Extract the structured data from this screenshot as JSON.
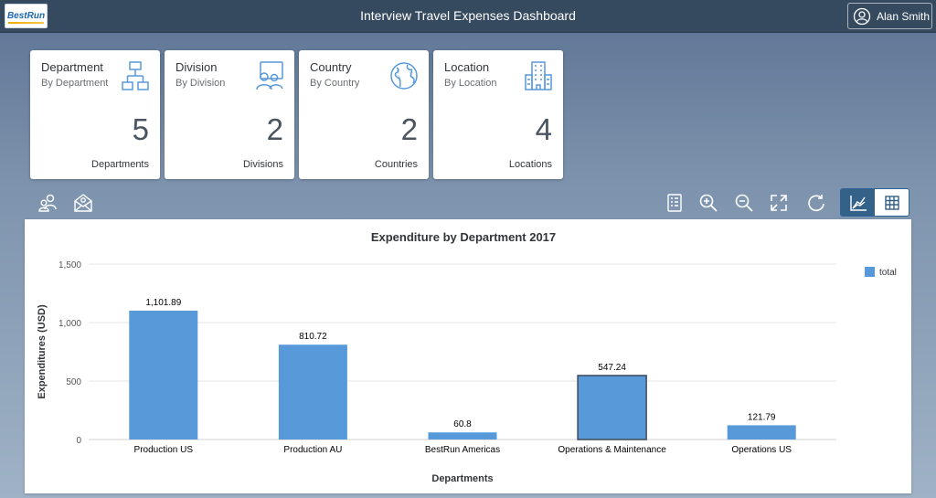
{
  "header": {
    "logo_text": "BestRun",
    "title": "Interview Travel Expenses Dashboard",
    "user_name": "Alan Smith"
  },
  "tiles": [
    {
      "title": "Department",
      "subtitle": "By Department",
      "value": "5",
      "unit": "Departments",
      "icon": "org-chart-icon"
    },
    {
      "title": "Division",
      "subtitle": "By Division",
      "value": "2",
      "unit": "Divisions",
      "icon": "group-icon"
    },
    {
      "title": "Country",
      "subtitle": "By Country",
      "value": "2",
      "unit": "Countries",
      "icon": "globe-icon"
    },
    {
      "title": "Location",
      "subtitle": "By Location",
      "value": "4",
      "unit": "Locations",
      "icon": "building-icon"
    }
  ],
  "toolbar": {
    "left_icons": [
      "users-icon",
      "envelope-icon"
    ],
    "right_icons": [
      "legend-icon",
      "zoom-in-icon",
      "zoom-out-icon",
      "fullscreen-icon",
      "refresh-icon"
    ],
    "view_toggle": [
      "line-chart-icon",
      "table-icon"
    ],
    "active_view": "line-chart-icon"
  },
  "colors": {
    "bar": "#5899da",
    "header": "#354a5f",
    "toggle_active": "#346187"
  },
  "chart_data": {
    "type": "bar",
    "title": "Expenditure by Department 2017",
    "xlabel": "Departments",
    "ylabel": "Expenditures (USD)",
    "categories": [
      "Production US",
      "Production AU",
      "BestRun Americas",
      "Operations & Maintenance",
      "Operations US"
    ],
    "series": [
      {
        "name": "total",
        "values": [
          1101.89,
          810.72,
          60.8,
          547.24,
          121.79
        ]
      }
    ],
    "data_labels": [
      "1,101.89",
      "810.72",
      "60.8",
      "547.24",
      "121.79"
    ],
    "ylim": [
      0,
      1500
    ],
    "yticks": [
      0,
      500,
      1000,
      1500
    ],
    "ytick_labels": [
      "0",
      "500",
      "1,000",
      "1,500"
    ],
    "grid": true,
    "legend": "top-right",
    "highlighted_category": "Operations & Maintenance"
  }
}
